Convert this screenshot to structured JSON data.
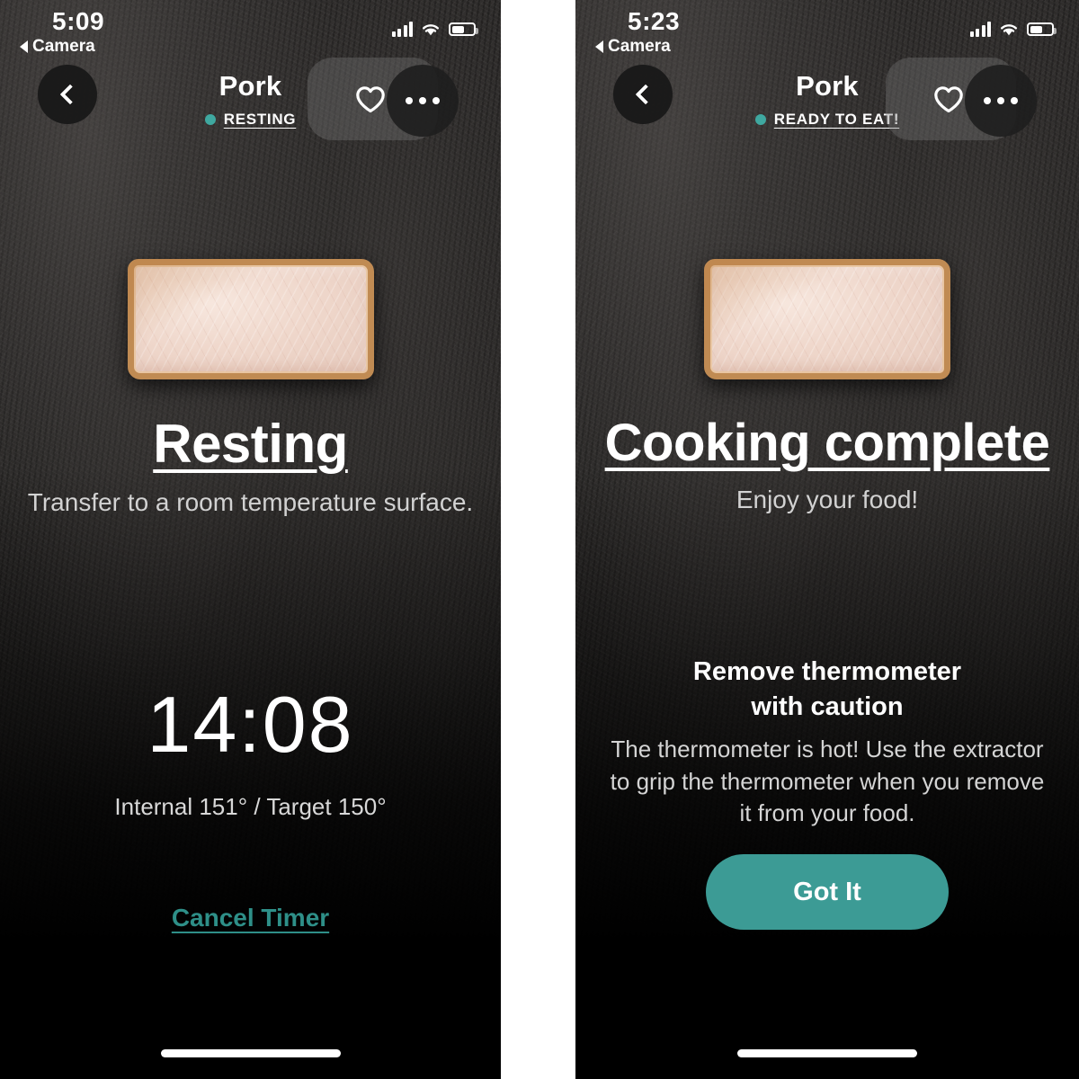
{
  "colors": {
    "accent_teal": "#3FA8A0",
    "link_teal": "#2E8F88",
    "button_teal": "#3C9B95",
    "bg_slate": "#211f1f",
    "bg_black": "#000000",
    "text_primary": "#FFFFFF",
    "text_secondary": "#D2D2D2",
    "meat_interior": "#EFD7CB",
    "meat_crust": "#C08B53"
  },
  "screens": [
    {
      "id": "resting-screen",
      "status_bar": {
        "time": "5:09",
        "back_app_label": "Camera",
        "signal_icon": "cellular-signal-icon",
        "wifi_icon": "wifi-icon",
        "battery_icon": "battery-icon",
        "battery_level_pct": 55
      },
      "nav": {
        "back_icon": "chevron-left-icon",
        "title": "Pork",
        "status_label": "RESTING",
        "status_dot": "status-dot-teal",
        "favorite_icon": "heart-icon",
        "more_icon": "more-horizontal-icon"
      },
      "food_image_alt": "cooked-pork-slice",
      "hero": {
        "heading": "Resting",
        "subtext": "Transfer to a room temperature surface."
      },
      "timer": {
        "value": "14:08",
        "temps": "Internal 151° / Target 150°"
      },
      "cancel_label": "Cancel Timer",
      "home_indicator": "home-indicator"
    },
    {
      "id": "cooking-complete-screen",
      "status_bar": {
        "time": "5:23",
        "back_app_label": "Camera",
        "signal_icon": "cellular-signal-icon",
        "wifi_icon": "wifi-icon",
        "battery_icon": "battery-icon",
        "battery_level_pct": 55
      },
      "nav": {
        "back_icon": "chevron-left-icon",
        "title": "Pork",
        "status_label": "READY TO EAT!",
        "status_dot": "status-dot-teal",
        "favorite_icon": "heart-icon",
        "more_icon": "more-horizontal-icon"
      },
      "food_image_alt": "cooked-pork-slice",
      "hero": {
        "heading": "Cooking complete",
        "subtext": "Enjoy your food!"
      },
      "caution": {
        "heading_line1": "Remove thermometer",
        "heading_line2": "with caution",
        "body": "The thermometer is hot! Use the extractor to grip the thermometer when you remove it from your food."
      },
      "primary_button_label": "Got It",
      "home_indicator": "home-indicator"
    }
  ]
}
